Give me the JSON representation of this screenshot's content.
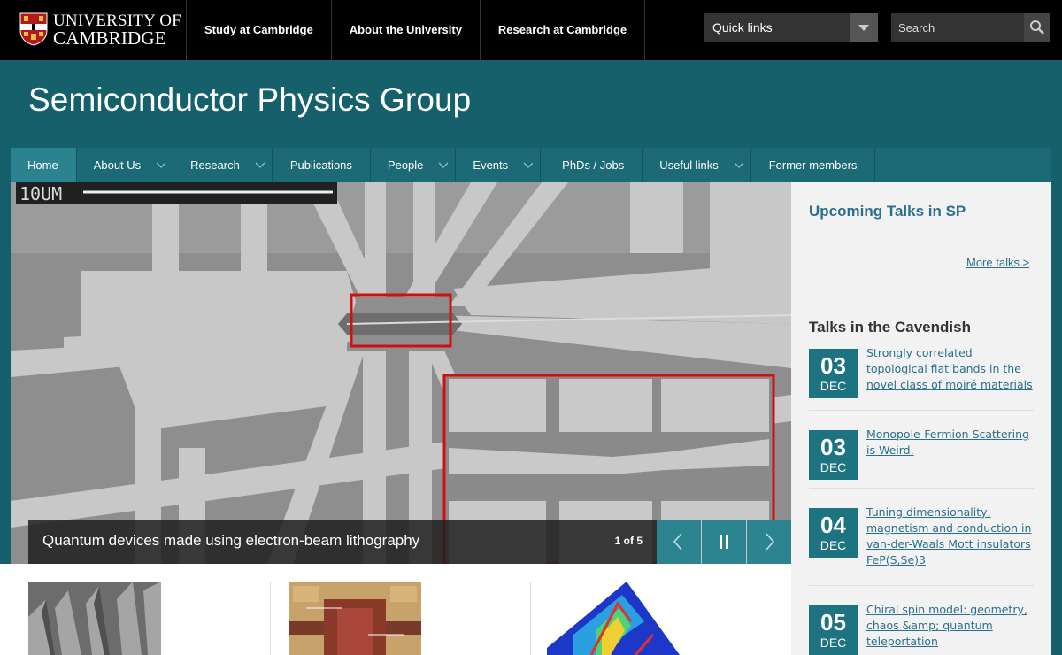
{
  "header": {
    "logo_text_line1": "UNIVERSITY OF",
    "logo_text_line2": "CAMBRIDGE",
    "nav": [
      "Study at Cambridge",
      "About the University",
      "Research at Cambridge"
    ],
    "quick_links_label": "Quick links",
    "search_placeholder": "Search"
  },
  "site": {
    "title": "Semiconductor Physics Group"
  },
  "main_nav": [
    {
      "label": "Home",
      "dropdown": false,
      "active": true
    },
    {
      "label": "About Us",
      "dropdown": true
    },
    {
      "label": "Research",
      "dropdown": true
    },
    {
      "label": "Publications",
      "dropdown": false
    },
    {
      "label": "People",
      "dropdown": true
    },
    {
      "label": "Events",
      "dropdown": true
    },
    {
      "label": "PhDs / Jobs",
      "dropdown": false
    },
    {
      "label": "Useful links",
      "dropdown": true
    },
    {
      "label": "Former members",
      "dropdown": false
    }
  ],
  "slider": {
    "scale_label": "10UM",
    "caption": "Quantum devices made using electron-beam lithography",
    "counter": "1 of 5"
  },
  "sidebar": {
    "upcoming_title": "Upcoming Talks in SP",
    "more_talks": "More talks >",
    "cavendish_title": "Talks in the Cavendish",
    "talks": [
      {
        "day": "03",
        "month": "DEC",
        "title": "Strongly correlated topological flat bands in the novel class of moiré materials"
      },
      {
        "day": "03",
        "month": "DEC",
        "title": "Monopole-Fermion Scattering is Weird."
      },
      {
        "day": "04",
        "month": "DEC",
        "title": "Tuning dimensionality, magnetism and conduction in van-der-Waals Mott insulators FeP(S,Se)3"
      },
      {
        "day": "05",
        "month": "DEC",
        "title": "Chiral spin model: geometry, chaos &amp; quantum teleportation"
      }
    ]
  },
  "colors": {
    "banner": "#16606c",
    "nav_active": "#2c8390",
    "date_box": "#1d7380",
    "link": "#2b6f8c"
  }
}
